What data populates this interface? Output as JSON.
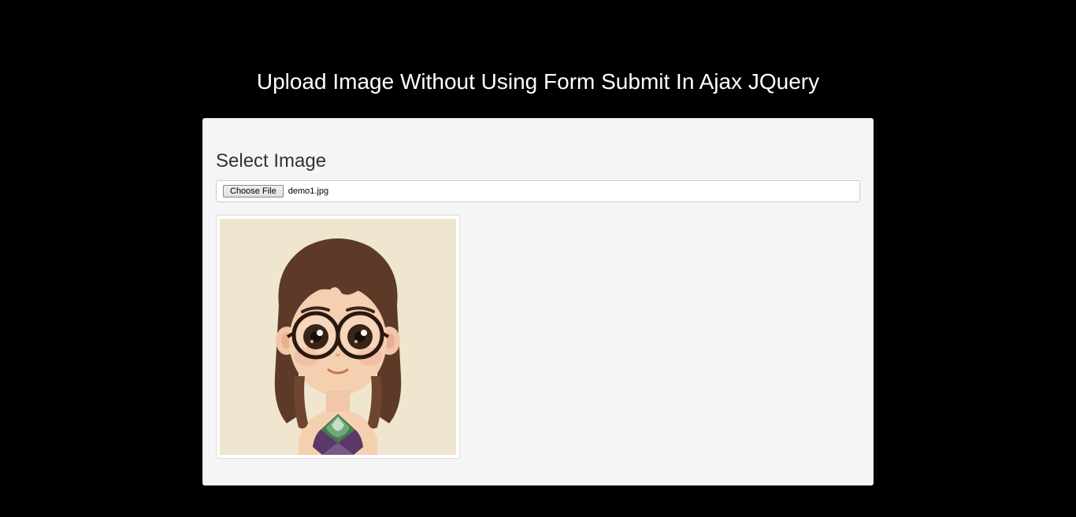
{
  "page": {
    "title": "Upload Image Without Using Form Submit In Ajax JQuery"
  },
  "upload": {
    "section_label": "Select Image",
    "choose_file_button": "Choose File",
    "selected_file": "demo1.jpg"
  }
}
